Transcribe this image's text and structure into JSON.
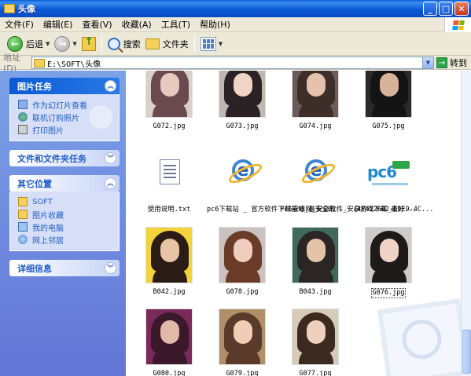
{
  "window": {
    "title": "头像"
  },
  "menu": [
    "文件(F)",
    "编辑(E)",
    "查看(V)",
    "收藏(A)",
    "工具(T)",
    "帮助(H)"
  ],
  "toolbar": {
    "back": "后退",
    "search": "搜索",
    "folders": "文件夹"
  },
  "address": {
    "label": "地址(D)",
    "value": "E:\\SOFT\\头像",
    "go": "转到"
  },
  "left_pane": {
    "picture_tasks": {
      "title": "图片任务",
      "items": [
        "作为幻灯片查看",
        "联机订购照片",
        "打印图片"
      ]
    },
    "file_tasks": {
      "title": "文件和文件夹任务"
    },
    "other_places": {
      "title": "其它位置",
      "items": [
        "SOFT",
        "图片收藏",
        "我的电脑",
        "网上邻居"
      ]
    },
    "details": {
      "title": "详细信息"
    }
  },
  "files": [
    {
      "name": "G072.jpg",
      "type": "portrait",
      "colors": [
        "#6b4a4f",
        "#e7c9c0",
        "#d9d1c9"
      ]
    },
    {
      "name": "G073.jpg",
      "type": "portrait",
      "colors": [
        "#2a2224",
        "#f0d4c5",
        "#bfb7b2"
      ]
    },
    {
      "name": "G074.jpg",
      "type": "portrait",
      "colors": [
        "#3e2e2a",
        "#e4c2ad",
        "#6a5a58"
      ]
    },
    {
      "name": "G075.jpg",
      "type": "portrait",
      "colors": [
        "#141414",
        "#d6b39a",
        "#2b2b2b"
      ]
    },
    {
      "name": "使用说明.txt",
      "type": "doc"
    },
    {
      "name": "pc6下载站 _ 官方软件下载基地_最安全的...",
      "type": "ie"
    },
    {
      "name": "Pc6安卓网_安卓软件_安卓游戏下载_最好...",
      "type": "ie"
    },
    {
      "name": "{4F422642-E9E9-4C...",
      "type": "pc6",
      "logo": "pc6"
    },
    {
      "name": "B042.jpg",
      "type": "portrait",
      "colors": [
        "#2b1d15",
        "#e8c4a7",
        "#f2d43a"
      ]
    },
    {
      "name": "G078.jpg",
      "type": "portrait",
      "colors": [
        "#6a3b26",
        "#f1cdbd",
        "#c9c2c0"
      ]
    },
    {
      "name": "B043.jpg",
      "type": "portrait",
      "colors": [
        "#2b2624",
        "#e4c3a6",
        "#3f6a5b"
      ]
    },
    {
      "name": "G076.jpg",
      "type": "portrait",
      "selected": true,
      "colors": [
        "#1e1a1a",
        "#efd3c6",
        "#cfcbc8"
      ]
    },
    {
      "name": "G080.jpg",
      "type": "portrait",
      "colors": [
        "#3a1a2a",
        "#e0b9a8",
        "#7a2a5a"
      ]
    },
    {
      "name": "G079.jpg",
      "type": "portrait",
      "colors": [
        "#5a3a2a",
        "#f0cdb6",
        "#b0906a"
      ]
    },
    {
      "name": "G077.jpg",
      "type": "portrait",
      "colors": [
        "#3a2a20",
        "#efcfbd",
        "#d6cbb8"
      ]
    }
  ]
}
